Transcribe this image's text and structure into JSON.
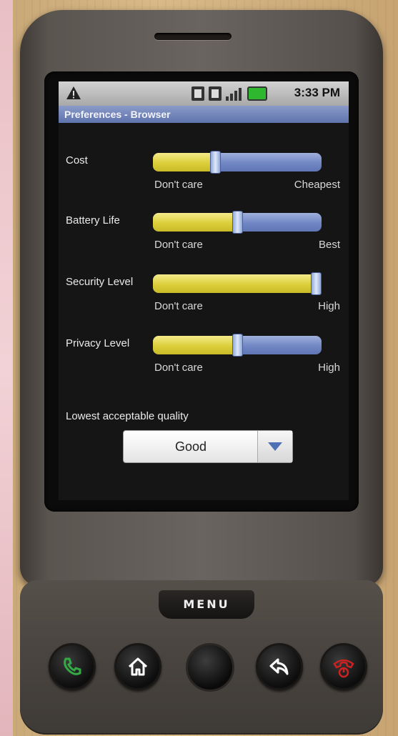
{
  "status_bar": {
    "time": "3:33 PM",
    "icons": [
      "warning-icon",
      "sim-icon",
      "sync-icon",
      "signal-icon",
      "battery-icon"
    ]
  },
  "title_bar": {
    "title": "Preferences - Browser"
  },
  "preferences": [
    {
      "label": "Cost",
      "min_label": "Don't care",
      "max_label": "Cheapest",
      "value": 0.36
    },
    {
      "label": "Battery Life",
      "min_label": "Don't care",
      "max_label": "Best",
      "value": 0.5
    },
    {
      "label": "Security Level",
      "min_label": "Don't care",
      "max_label": "High",
      "value": 1.0
    },
    {
      "label": "Privacy Level",
      "min_label": "Don't care",
      "max_label": "High",
      "value": 0.5
    }
  ],
  "quality": {
    "label": "Lowest acceptable quality",
    "selected": "Good"
  },
  "hardware": {
    "menu_label": "MENU"
  },
  "colors": {
    "slider_fill": "#dccf3a",
    "slider_track": "#7187c4",
    "title_bar": "#5f73ad",
    "end_call": "#cc2222",
    "call": "#33aa44"
  }
}
